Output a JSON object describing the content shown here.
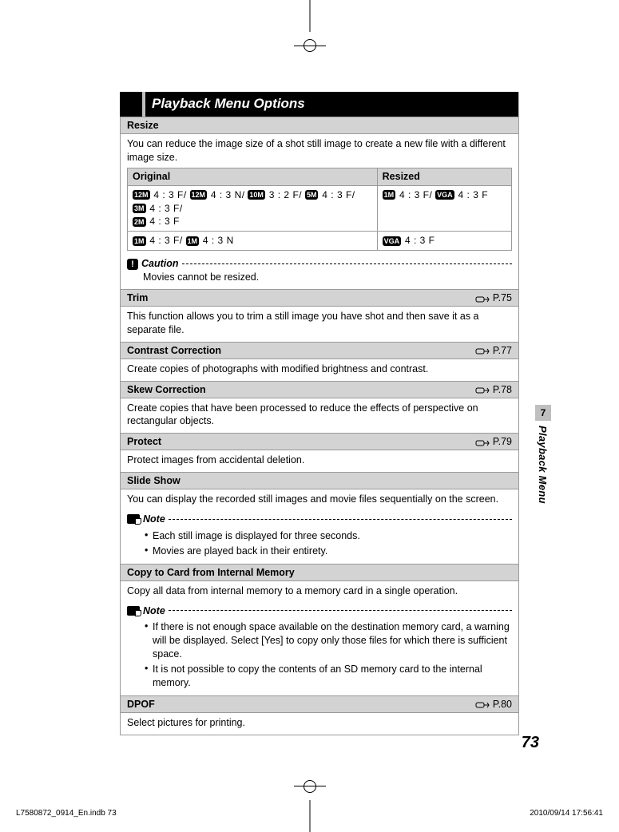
{
  "title": "Playback Menu Options",
  "sections": {
    "resize": {
      "header": "Resize",
      "desc": "You can reduce the image size of a shot still image to create a new file with a different image size.",
      "table": {
        "col_original": "Original",
        "col_resized": "Resized",
        "rows": [
          {
            "original_badges": [
              "12M",
              "12M",
              "10M",
              "5M",
              "3M",
              "2M"
            ],
            "original_vals": [
              " 4 : 3 F/ ",
              " 4 : 3 N/ ",
              " 3 : 2 F/ ",
              " 4 : 3 F/ ",
              " 4 : 3 F/ ",
              " 4 : 3 F"
            ],
            "resized_badges": [
              "1M",
              "VGA"
            ],
            "resized_vals": [
              " 4 : 3 F/ ",
              " 4 : 3 F"
            ]
          },
          {
            "original_badges": [
              "1M",
              "1M"
            ],
            "original_vals": [
              " 4 : 3 F/ ",
              " 4 : 3 N"
            ],
            "resized_badges": [
              "VGA"
            ],
            "resized_vals": [
              " 4 : 3 F"
            ]
          }
        ]
      },
      "caution_label": "Caution",
      "caution_text": "Movies cannot be resized."
    },
    "trim": {
      "header": "Trim",
      "pref": "P.75",
      "desc": "This function allows you to trim a still image you have shot and then save it as a separate file."
    },
    "contrast": {
      "header": "Contrast Correction",
      "pref": "P.77",
      "desc": "Create copies of photographs with modified brightness and contrast."
    },
    "skew": {
      "header": "Skew Correction",
      "pref": "P.78",
      "desc": "Create copies that have been processed to reduce the effects of perspective on rectangular objects."
    },
    "protect": {
      "header": "Protect",
      "pref": "P.79",
      "desc": "Protect images from accidental deletion."
    },
    "slideshow": {
      "header": "Slide Show",
      "desc": "You can display the recorded still images and movie files sequentially on the screen.",
      "note_label": "Note",
      "notes": [
        "Each still image is displayed for three seconds.",
        "Movies are played back in their entirety."
      ]
    },
    "copy": {
      "header": "Copy to Card from Internal Memory",
      "desc": "Copy all data from internal memory to a memory card in a single operation.",
      "note_label": "Note",
      "notes": [
        "If there is not enough space available on the destination memory card, a warning will be displayed. Select [Yes] to copy only those files for which there is sufficient space.",
        "It is not possible to copy the contents of an SD memory card to the internal memory."
      ]
    },
    "dpof": {
      "header": "DPOF",
      "pref": "P.80",
      "desc": "Select pictures for printing."
    }
  },
  "side": {
    "chapter": "7",
    "label": "Playback Menu"
  },
  "page_number": "73",
  "footer": {
    "left": "L7580872_0914_En.indb   73",
    "right": "2010/09/14   17:56:41"
  }
}
